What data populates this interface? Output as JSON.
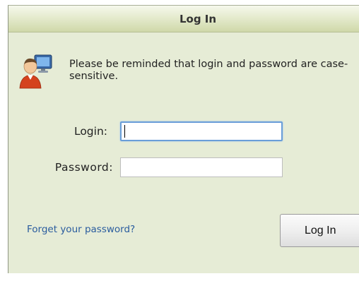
{
  "dialog": {
    "title": "Log In",
    "notice": "Please be reminded that login and password are case-sensitive."
  },
  "form": {
    "login_label": "Login:",
    "login_value": "",
    "password_label": "Password:",
    "password_value": ""
  },
  "actions": {
    "forgot_link": "Forget your password?",
    "login_button": "Log In"
  },
  "icons": {
    "user": "user-computer-icon"
  },
  "colors": {
    "panel_background": "#e6ecd6",
    "title_bar": "#dde4bf",
    "link": "#2a5c9e",
    "focus_border": "#6a9ed8"
  }
}
